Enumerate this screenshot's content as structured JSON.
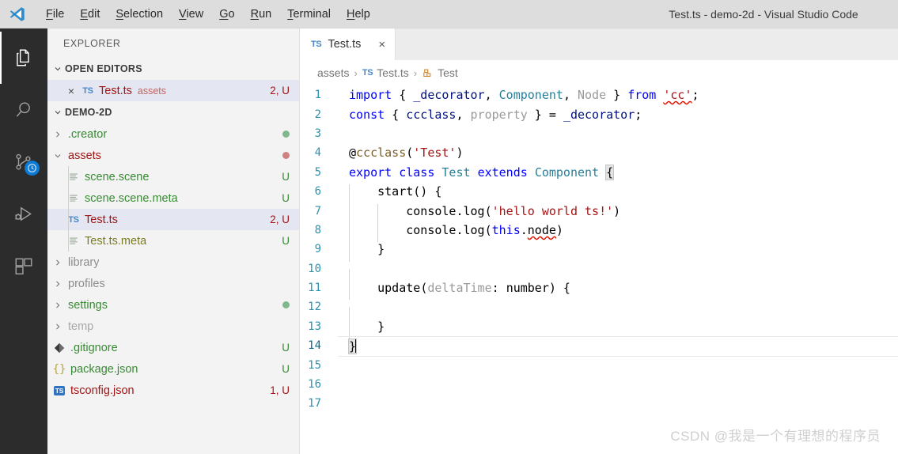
{
  "window": {
    "title": "Test.ts - demo-2d - Visual Studio Code",
    "logo_icon": "vscode-logo-icon"
  },
  "menubar": {
    "items": [
      {
        "label": "File",
        "mnemonic": "F"
      },
      {
        "label": "Edit",
        "mnemonic": "E"
      },
      {
        "label": "Selection",
        "mnemonic": "S"
      },
      {
        "label": "View",
        "mnemonic": "V"
      },
      {
        "label": "Go",
        "mnemonic": "G"
      },
      {
        "label": "Run",
        "mnemonic": "R"
      },
      {
        "label": "Terminal",
        "mnemonic": "T"
      },
      {
        "label": "Help",
        "mnemonic": "H"
      }
    ]
  },
  "activitybar": {
    "items": [
      {
        "name": "explorer-icon",
        "active": true
      },
      {
        "name": "search-icon",
        "active": false
      },
      {
        "name": "source-control-icon",
        "active": false,
        "badge": "clock-badge"
      },
      {
        "name": "run-debug-icon",
        "active": false
      },
      {
        "name": "extensions-icon",
        "active": false
      }
    ]
  },
  "sidebar": {
    "title": "EXPLORER",
    "open_editors": {
      "header": "OPEN EDITORS",
      "expanded": true,
      "items": [
        {
          "name": "Test.ts",
          "description": "assets",
          "badge": "2, U",
          "icon": "ts-file-icon",
          "selected": true,
          "close": "×"
        }
      ]
    },
    "workspace": {
      "header": "DEMO-2D",
      "expanded": true,
      "items": [
        {
          "label": ".creator",
          "type": "folder",
          "expanded": false,
          "depth": 1,
          "dot": "#81b88b",
          "color": "#388a34"
        },
        {
          "label": "assets",
          "type": "folder",
          "expanded": true,
          "depth": 1,
          "dot": "#cf8080",
          "color": "#a31515"
        },
        {
          "label": "scene.scene",
          "type": "file",
          "depth": 2,
          "badge": "U",
          "icon": "text-file-icon",
          "color": "#388a34",
          "badge_color": "#388a34"
        },
        {
          "label": "scene.scene.meta",
          "type": "file",
          "depth": 2,
          "badge": "U",
          "icon": "text-file-icon",
          "color": "#388a34",
          "badge_color": "#388a34"
        },
        {
          "label": "Test.ts",
          "type": "file",
          "depth": 2,
          "badge": "2, U",
          "icon": "ts-file-icon",
          "color": "#a31515",
          "badge_color": "#a31515",
          "selected": true
        },
        {
          "label": "Test.ts.meta",
          "type": "file",
          "depth": 2,
          "badge": "U",
          "icon": "text-file-icon",
          "color": "#7a7a20",
          "badge_color": "#388a34"
        },
        {
          "label": "library",
          "type": "folder",
          "expanded": false,
          "depth": 1,
          "color": "#8c8c8c"
        },
        {
          "label": "profiles",
          "type": "folder",
          "expanded": false,
          "depth": 1,
          "color": "#8c8c8c"
        },
        {
          "label": "settings",
          "type": "folder",
          "expanded": false,
          "depth": 1,
          "dot": "#81b88b",
          "color": "#388a34"
        },
        {
          "label": "temp",
          "type": "folder",
          "expanded": false,
          "depth": 1,
          "color": "#a8a8a8"
        },
        {
          "label": ".gitignore",
          "type": "file",
          "depth": 1,
          "badge": "U",
          "icon": "git-icon",
          "color": "#388a34",
          "badge_color": "#388a34"
        },
        {
          "label": "package.json",
          "type": "file",
          "depth": 1,
          "badge": "U",
          "icon": "json-icon",
          "color": "#388a34",
          "badge_color": "#388a34"
        },
        {
          "label": "tsconfig.json",
          "type": "file",
          "depth": 1,
          "badge": "1, U",
          "icon": "ts-square-icon",
          "color": "#a31515",
          "badge_color": "#a31515"
        }
      ]
    }
  },
  "editor": {
    "tabs": [
      {
        "label": "Test.ts",
        "icon": "ts-file-icon",
        "close": "×",
        "active": true
      }
    ],
    "breadcrumbs": [
      {
        "label": "assets",
        "icon": null
      },
      {
        "label": "Test.ts",
        "icon": "ts-file-icon"
      },
      {
        "label": "Test",
        "icon": "class-symbol-icon"
      }
    ],
    "separator": "›",
    "current_line": 14,
    "lines": [
      {
        "n": 1,
        "indent": 0,
        "tokens": [
          {
            "t": "import",
            "c": "k"
          },
          {
            "t": " { ",
            "c": "op"
          },
          {
            "t": "_decorator",
            "c": "va"
          },
          {
            "t": ", ",
            "c": "op"
          },
          {
            "t": "Component",
            "c": "ty"
          },
          {
            "t": ", ",
            "c": "op"
          },
          {
            "t": "Node",
            "c": "pa"
          },
          {
            "t": " } ",
            "c": "op"
          },
          {
            "t": "from",
            "c": "k"
          },
          {
            "t": " ",
            "c": "op"
          },
          {
            "t": "'cc'",
            "c": "s squig"
          },
          {
            "t": ";",
            "c": "op"
          }
        ]
      },
      {
        "n": 2,
        "indent": 0,
        "tokens": [
          {
            "t": "const",
            "c": "k"
          },
          {
            "t": " { ",
            "c": "op"
          },
          {
            "t": "ccclass",
            "c": "va"
          },
          {
            "t": ", ",
            "c": "op"
          },
          {
            "t": "property",
            "c": "pa"
          },
          {
            "t": " } = ",
            "c": "op"
          },
          {
            "t": "_decorator",
            "c": "va"
          },
          {
            "t": ";",
            "c": "op"
          }
        ]
      },
      {
        "n": 3,
        "indent": 0,
        "tokens": []
      },
      {
        "n": 4,
        "indent": 0,
        "tokens": [
          {
            "t": "@",
            "c": "op"
          },
          {
            "t": "ccclass",
            "c": "dec"
          },
          {
            "t": "(",
            "c": "op"
          },
          {
            "t": "'Test'",
            "c": "s"
          },
          {
            "t": ")",
            "c": "op"
          }
        ]
      },
      {
        "n": 5,
        "indent": 0,
        "tokens": [
          {
            "t": "export",
            "c": "k"
          },
          {
            "t": " ",
            "c": "op"
          },
          {
            "t": "class",
            "c": "k"
          },
          {
            "t": " ",
            "c": "op"
          },
          {
            "t": "Test",
            "c": "ty"
          },
          {
            "t": " ",
            "c": "op"
          },
          {
            "t": "extends",
            "c": "k"
          },
          {
            "t": " ",
            "c": "op"
          },
          {
            "t": "Component",
            "c": "ty"
          },
          {
            "t": " ",
            "c": "op"
          },
          {
            "t": "{",
            "c": "op bmatch"
          }
        ]
      },
      {
        "n": 6,
        "indent": 1,
        "tokens": [
          {
            "t": "    ",
            "c": "op"
          },
          {
            "t": "start",
            "c": "op"
          },
          {
            "t": "() {",
            "c": "op"
          }
        ]
      },
      {
        "n": 7,
        "indent": 2,
        "tokens": [
          {
            "t": "        ",
            "c": "op"
          },
          {
            "t": "console",
            "c": "op"
          },
          {
            "t": ".",
            "c": "op"
          },
          {
            "t": "log",
            "c": "op"
          },
          {
            "t": "(",
            "c": "op"
          },
          {
            "t": "'hello world ts!'",
            "c": "s"
          },
          {
            "t": ")",
            "c": "op"
          }
        ]
      },
      {
        "n": 8,
        "indent": 2,
        "tokens": [
          {
            "t": "        ",
            "c": "op"
          },
          {
            "t": "console",
            "c": "op"
          },
          {
            "t": ".",
            "c": "op"
          },
          {
            "t": "log",
            "c": "op"
          },
          {
            "t": "(",
            "c": "op"
          },
          {
            "t": "this",
            "c": "k"
          },
          {
            "t": ".",
            "c": "op"
          },
          {
            "t": "node",
            "c": "op squig"
          },
          {
            "t": ")",
            "c": "op"
          }
        ]
      },
      {
        "n": 9,
        "indent": 1,
        "tokens": [
          {
            "t": "    }",
            "c": "op"
          }
        ]
      },
      {
        "n": 10,
        "indent": 1,
        "tokens": []
      },
      {
        "n": 11,
        "indent": 1,
        "tokens": [
          {
            "t": "    ",
            "c": "op"
          },
          {
            "t": "update",
            "c": "op"
          },
          {
            "t": "(",
            "c": "op"
          },
          {
            "t": "deltaTime",
            "c": "pa"
          },
          {
            "t": ": ",
            "c": "op"
          },
          {
            "t": "number",
            "c": "op"
          },
          {
            "t": ") {",
            "c": "op"
          }
        ]
      },
      {
        "n": 12,
        "indent": 1,
        "tokens": []
      },
      {
        "n": 13,
        "indent": 1,
        "tokens": [
          {
            "t": "    }",
            "c": "op"
          }
        ]
      },
      {
        "n": 14,
        "indent": 0,
        "current": true,
        "cursor": true,
        "tokens": [
          {
            "t": "}",
            "c": "op bmatch"
          }
        ]
      },
      {
        "n": 15,
        "indent": 0,
        "tokens": []
      },
      {
        "n": 16,
        "indent": 0,
        "tokens": []
      },
      {
        "n": 17,
        "indent": 0,
        "tokens": []
      }
    ]
  },
  "watermark": {
    "text": "CSDN @我是一个有理想的程序员"
  }
}
